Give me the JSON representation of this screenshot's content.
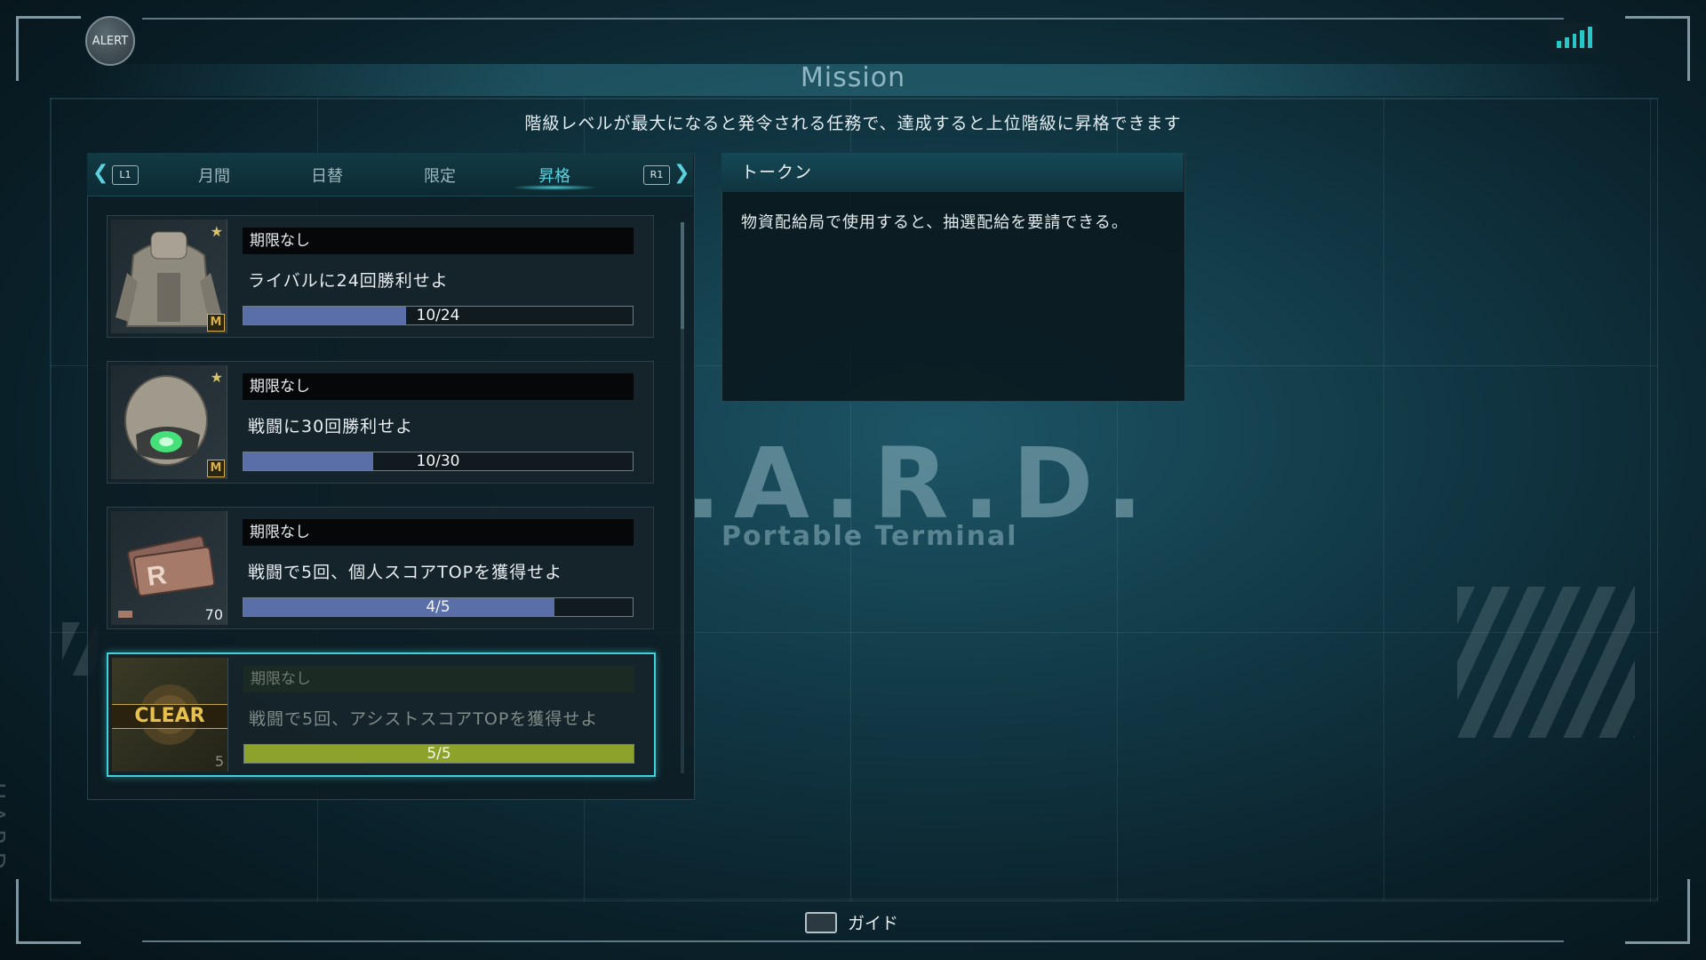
{
  "header": {
    "alert_label": "ALERT",
    "title": "Mission",
    "subtitle": "階級レベルが最大になると発令される任務で、達成すると上位階級に昇格できます"
  },
  "watermark": {
    "main": ".A.R.D.",
    "sub": "Portable Terminal",
    "side": "H.A.R.D."
  },
  "tabs": {
    "left_button": "L1",
    "right_button": "R1",
    "items": [
      {
        "label": "月間"
      },
      {
        "label": "日替"
      },
      {
        "label": "限定"
      },
      {
        "label": "昇格",
        "active": true
      }
    ]
  },
  "missions": [
    {
      "limit": "期限なし",
      "description": "ライバルに24回勝利せよ",
      "progress_text": "10/24",
      "progress": 0.4167,
      "reward": "armor-jacket",
      "badge": "M",
      "starred": true,
      "cleared": false
    },
    {
      "limit": "期限なし",
      "description": "戦闘に30回勝利せよ",
      "progress_text": "10/30",
      "progress": 0.3333,
      "reward": "helmet",
      "badge": "M",
      "starred": true,
      "cleared": false
    },
    {
      "limit": "期限なし",
      "description": "戦闘で5回、個人スコアTOPを獲得せよ",
      "progress_text": "4/5",
      "progress": 0.8,
      "reward": "recycle-ticket",
      "badge": "70",
      "starred": false,
      "cleared": false
    },
    {
      "limit": "期限なし",
      "description": "戦闘で5回、アシストスコアTOPを獲得せよ",
      "progress_text": "5/5",
      "progress": 1.0,
      "reward": "token",
      "badge": "5",
      "starred": false,
      "cleared": true,
      "clear_label": "CLEAR"
    }
  ],
  "detail": {
    "title": "トークン",
    "text": "物資配給局で使用すると、抽選配給を要請できる。"
  },
  "footer": {
    "guide_label": "ガイド"
  },
  "colors": {
    "accent": "#59d4e0",
    "progress_fill": "#5a6ea8",
    "clear_fill": "#8da22a",
    "signal": "#27c6c7"
  }
}
